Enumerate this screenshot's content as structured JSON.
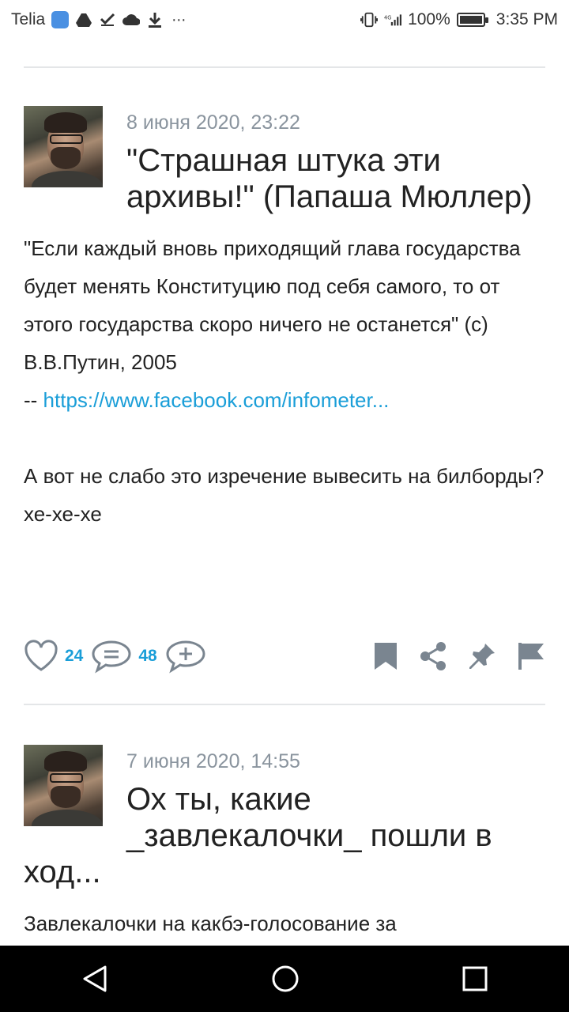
{
  "status_bar": {
    "carrier": "Telia",
    "battery": "100%",
    "battery_level": 1.0,
    "time": "3:35 PM",
    "network": "4G"
  },
  "posts": [
    {
      "date": "8 июня 2020, 23:22",
      "title": "\"Страшная штука эти архивы!\" (Папаша Мюллер)",
      "body": [
        "\"Если каждый вновь приходящий глава государства будет менять Конституцию под себя самого, то от этого государства скоро ничего не останется\" (с) В.В.Путин, 2005"
      ],
      "link_prefix": "-- ",
      "link": "https://www.facebook.com/infometer...",
      "body2": [
        "А вот не слабо это изречение вывесить на билборды?",
        "хе-хе-хе"
      ],
      "likes": "24",
      "comments": "48"
    },
    {
      "date": "7 июня 2020, 14:55",
      "title": "Ох ты, какие _завлекалочки_ пошли в ход...",
      "body": [
        "Завлекалочки на какбэ-голосование за"
      ]
    }
  ],
  "icons": {
    "like": "heart-icon",
    "comment": "comment-icon",
    "add_comment": "add-comment-icon",
    "bookmark": "bookmark-icon",
    "share": "share-icon",
    "pin": "pin-icon",
    "flag": "flag-icon"
  },
  "colors": {
    "accent": "#1a9ed8",
    "date": "#8a949e",
    "divider": "#e4e6e8",
    "icon": "#7a8590"
  }
}
